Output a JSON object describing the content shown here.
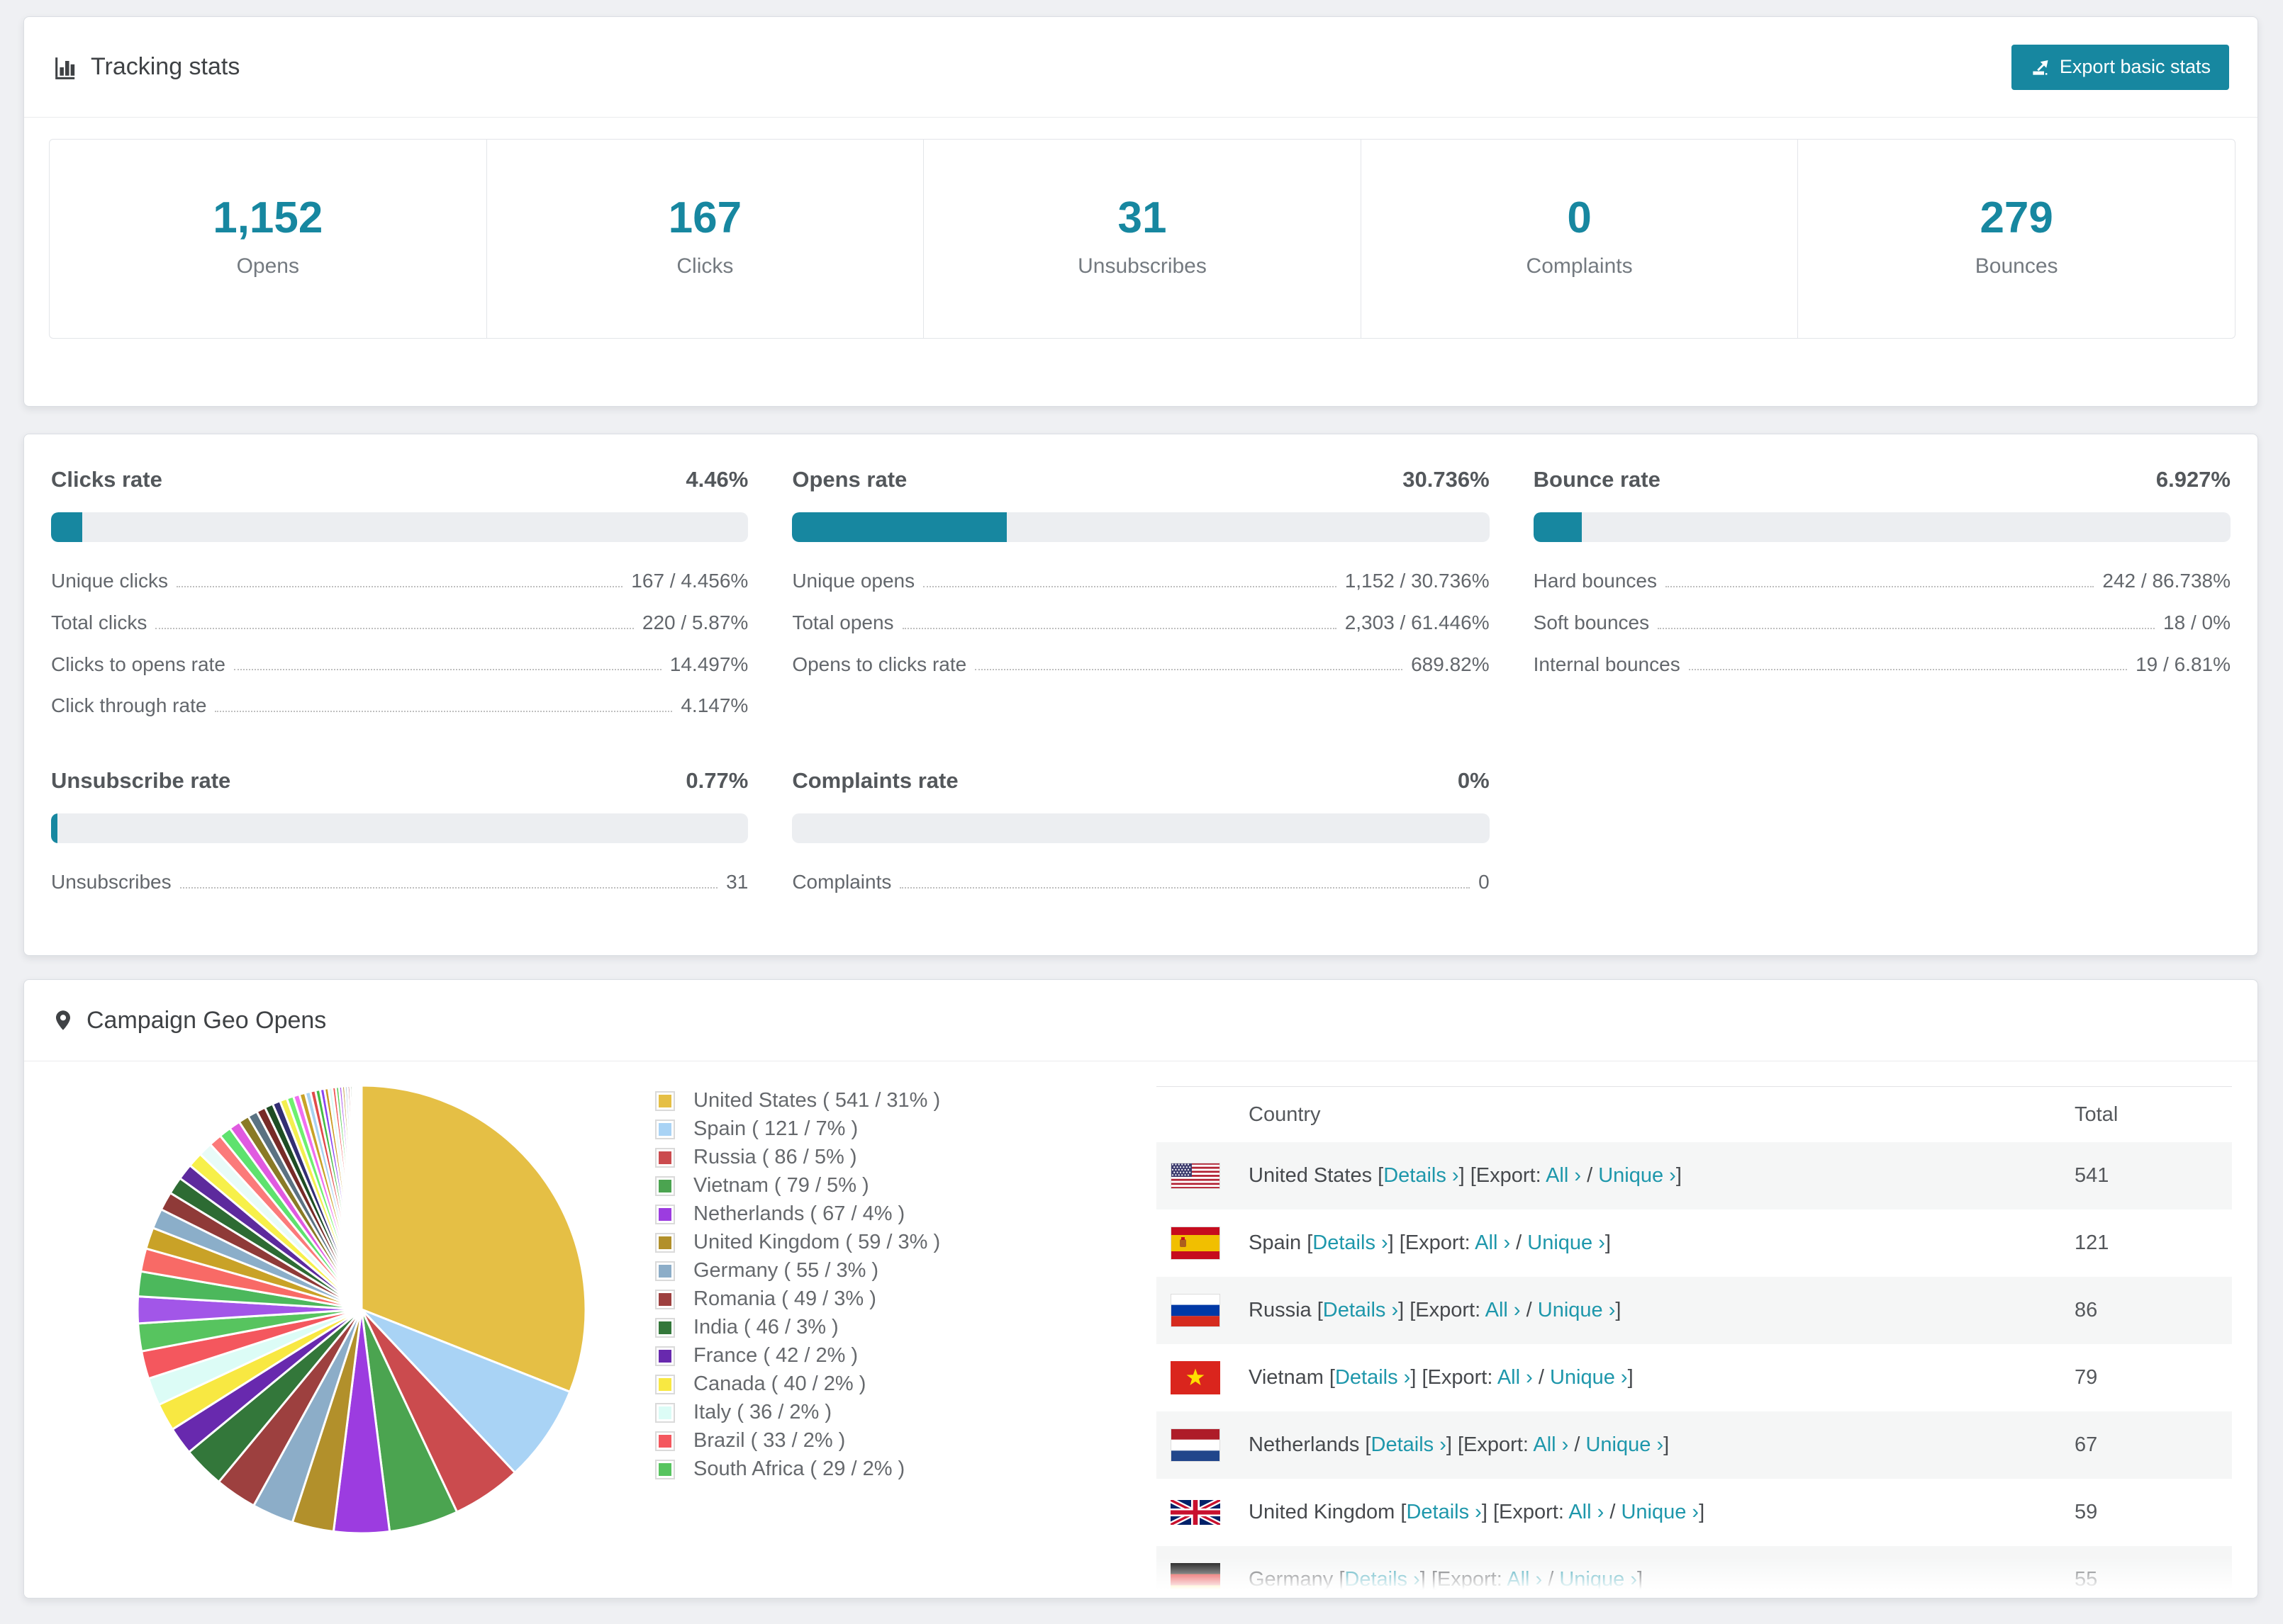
{
  "accent": {
    "teal": "#1787a0",
    "link_color": "#1e97ab"
  },
  "tracking_stats": {
    "title": "Tracking stats",
    "export_button": "Export basic stats",
    "summary": [
      {
        "value": "1,152",
        "label": "Opens"
      },
      {
        "value": "167",
        "label": "Clicks"
      },
      {
        "value": "31",
        "label": "Unsubscribes"
      },
      {
        "value": "0",
        "label": "Complaints"
      },
      {
        "value": "279",
        "label": "Bounces"
      }
    ]
  },
  "rates": [
    {
      "title": "Clicks rate",
      "value_label": "4.46%",
      "pct": 4.46,
      "rows": [
        {
          "label": "Unique clicks",
          "value": "167 / 4.456%"
        },
        {
          "label": "Total clicks",
          "value": "220 / 5.87%"
        },
        {
          "label": "Clicks to opens rate",
          "value": "14.497%"
        },
        {
          "label": "Click through rate",
          "value": "4.147%"
        }
      ]
    },
    {
      "title": "Opens rate",
      "value_label": "30.736%",
      "pct": 30.736,
      "rows": [
        {
          "label": "Unique opens",
          "value": "1,152 / 30.736%"
        },
        {
          "label": "Total opens",
          "value": "2,303 / 61.446%"
        },
        {
          "label": "Opens to clicks rate",
          "value": "689.82%"
        }
      ]
    },
    {
      "title": "Bounce rate",
      "value_label": "6.927%",
      "pct": 6.927,
      "rows": [
        {
          "label": "Hard bounces",
          "value": "242 / 86.738%"
        },
        {
          "label": "Soft bounces",
          "value": "18 / 0%"
        },
        {
          "label": "Internal bounces",
          "value": "19 / 6.81%"
        }
      ]
    },
    {
      "title": "Unsubscribe rate",
      "value_label": "0.77%",
      "pct": 0.77,
      "rows": [
        {
          "label": "Unsubscribes",
          "value": "31"
        }
      ]
    },
    {
      "title": "Complaints rate",
      "value_label": "0%",
      "pct": 0,
      "rows": [
        {
          "label": "Complaints",
          "value": "0"
        }
      ]
    }
  ],
  "geo": {
    "title": "Campaign Geo Opens",
    "table": {
      "headers": [
        "Country",
        "Total"
      ],
      "link_labels": {
        "details": "Details ›",
        "export": "Export:",
        "all": "All ›",
        "unique": "Unique ›"
      },
      "punct": {
        "lb": "[",
        "rb": "]",
        "sep": "/"
      },
      "rows": [
        {
          "country": "United States",
          "flag": "us",
          "total": "541"
        },
        {
          "country": "Spain",
          "flag": "es",
          "total": "121"
        },
        {
          "country": "Russia",
          "flag": "ru",
          "total": "86"
        },
        {
          "country": "Vietnam",
          "flag": "vn",
          "total": "79"
        },
        {
          "country": "Netherlands",
          "flag": "nl",
          "total": "67"
        },
        {
          "country": "United Kingdom",
          "flag": "gb",
          "total": "59"
        },
        {
          "country": "Germany",
          "flag": "de",
          "total": "55"
        }
      ]
    }
  },
  "chart_data": {
    "type": "pie",
    "title": "Campaign Geo Opens",
    "unit": "opens",
    "legend_position": "right",
    "start_angle_deg": 0,
    "direction": "clockwise",
    "slices": [
      {
        "label": "United States",
        "value": 541,
        "pct": 31,
        "color": "#e5bf45"
      },
      {
        "label": "Spain",
        "value": 121,
        "pct": 7,
        "color": "#a9d3f5"
      },
      {
        "label": "Russia",
        "value": 86,
        "pct": 5,
        "color": "#cb4b4e"
      },
      {
        "label": "Vietnam",
        "value": 79,
        "pct": 5,
        "color": "#4ba450"
      },
      {
        "label": "Netherlands",
        "value": 67,
        "pct": 4,
        "color": "#9c3ce0"
      },
      {
        "label": "United Kingdom",
        "value": 59,
        "pct": 3,
        "color": "#b2902b"
      },
      {
        "label": "Germany",
        "value": 55,
        "pct": 3,
        "color": "#8cadc8"
      },
      {
        "label": "Romania",
        "value": 49,
        "pct": 3,
        "color": "#9d403f"
      },
      {
        "label": "India",
        "value": 46,
        "pct": 3,
        "color": "#33773a"
      },
      {
        "label": "France",
        "value": 42,
        "pct": 2,
        "color": "#6829ae"
      },
      {
        "label": "Canada",
        "value": 40,
        "pct": 2,
        "color": "#f8e842"
      },
      {
        "label": "Italy",
        "value": 36,
        "pct": 2,
        "color": "#dcfcf6"
      },
      {
        "label": "Brazil",
        "value": 33,
        "pct": 2,
        "color": "#f4575e"
      },
      {
        "label": "South Africa",
        "value": 29,
        "pct": 2,
        "color": "#57c45f"
      }
    ],
    "others": {
      "total_pct": 26,
      "slice_count": 40,
      "decay": 0.93,
      "palette": [
        "#a256e8",
        "#4cb85c",
        "#f86a66",
        "#c9a227",
        "#8baec9",
        "#8f3a38",
        "#2d6b33",
        "#5d2a9d",
        "#f7f04a",
        "#e8fbf8",
        "#fb7a7a",
        "#5ee26e",
        "#e05ae0",
        "#8a7a26",
        "#5b7282",
        "#772b28",
        "#1e4d24",
        "#332e73",
        "#f4ef4f",
        "#6ef06e",
        "#f06ef0",
        "#c9a227",
        "#a8d2f0",
        "#e04a4a",
        "#44bb44",
        "#8a44f0",
        "#cc9922",
        "#d8fbf7",
        "#f05555",
        "#55cc55",
        "#aa55ee",
        "#bb9933",
        "#99bbd4",
        "#aa4444",
        "#336633",
        "#7733bb"
      ]
    }
  }
}
